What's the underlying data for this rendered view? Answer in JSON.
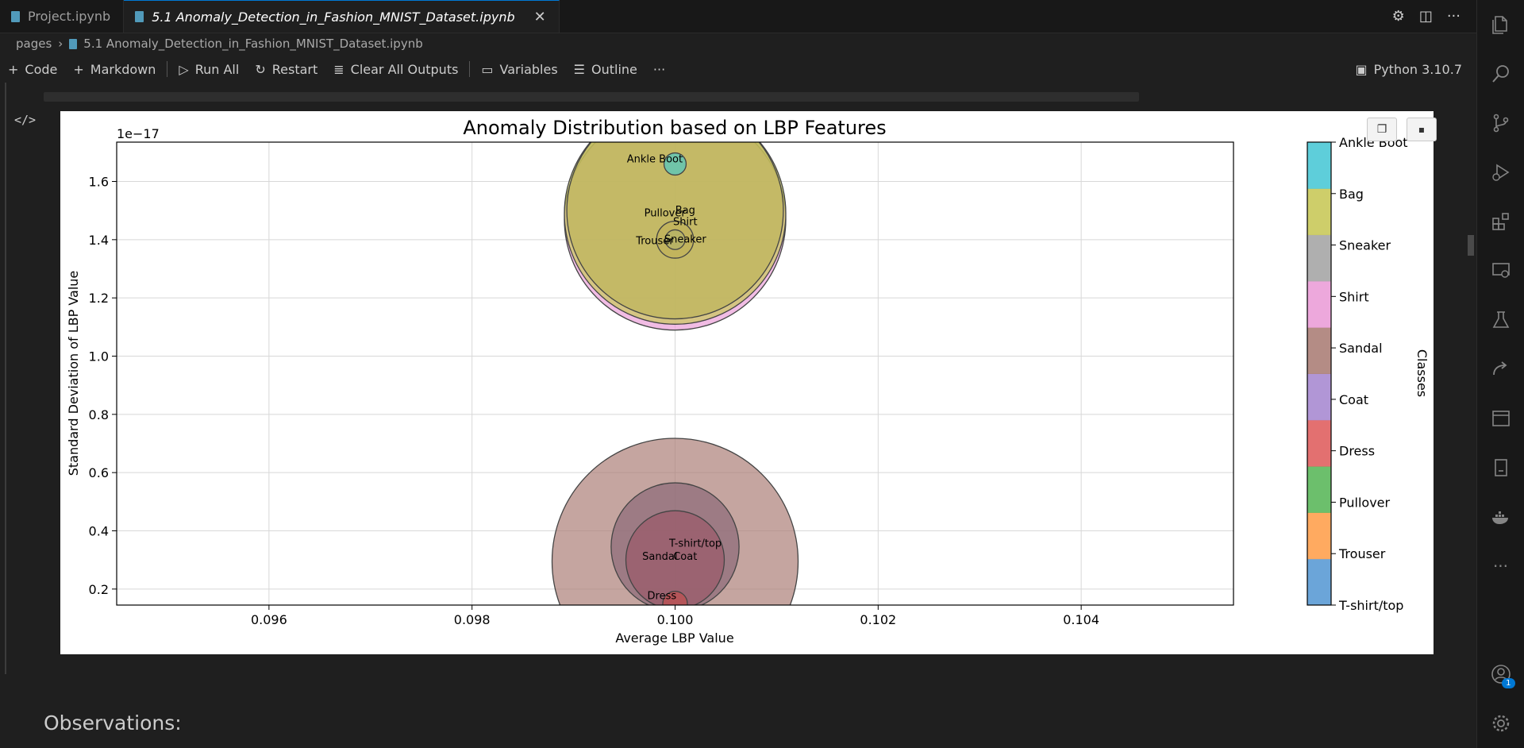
{
  "tabs": [
    {
      "label": "Project.ipynb",
      "active": false
    },
    {
      "label": "5.1 Anomaly_Detection_in_Fashion_MNIST_Dataset.ipynb",
      "active": true
    }
  ],
  "breadcrumb": {
    "folder": "pages",
    "file": "5.1 Anomaly_Detection_in_Fashion_MNIST_Dataset.ipynb"
  },
  "toolbar": {
    "code": "Code",
    "markdown": "Markdown",
    "run_all": "Run All",
    "restart": "Restart",
    "clear_outputs": "Clear All Outputs",
    "variables": "Variables",
    "outline": "Outline",
    "more": "···",
    "kernel": "Python 3.10.7"
  },
  "activity_badge": "1",
  "markdown_heading": "Observations:",
  "chart_data": {
    "type": "scatter",
    "title": "Anomaly Distribution based on LBP Features",
    "xlabel": "Average LBP Value",
    "ylabel": "Standard Deviation of LBP Value",
    "y_offset_label": "1e−17",
    "xlim": [
      0.0945,
      0.1055
    ],
    "ylim": [
      0.145,
      1.735
    ],
    "x_ticks": [
      "0.096",
      "0.098",
      "0.100",
      "0.102",
      "0.104"
    ],
    "y_ticks": [
      "0.2",
      "0.4",
      "0.6",
      "0.8",
      "1.0",
      "1.2",
      "1.4",
      "1.6"
    ],
    "grid": true,
    "colorbar": {
      "label": "Classes",
      "classes": [
        "T-shirt/top",
        "Trouser",
        "Pullover",
        "Dress",
        "Coat",
        "Sandal",
        "Shirt",
        "Sneaker",
        "Bag",
        "Ankle Boot"
      ],
      "colors": [
        "#5b9bd5",
        "#ffa14f",
        "#5cb85c",
        "#e06060",
        "#a98bd2",
        "#ac7f78",
        "#eb9fd8",
        "#a6a6a6",
        "#c9c95a",
        "#4dc9d6"
      ]
    },
    "points": [
      {
        "label": "Sandal",
        "x": 0.1,
        "y": 0.295,
        "size": 1.0,
        "color": "#ac7f78"
      },
      {
        "label": "T-shirt/top",
        "x": 0.1,
        "y": 0.345,
        "size": 0.52,
        "color": "#8c6a78"
      },
      {
        "label": "Coat",
        "x": 0.1,
        "y": 0.3,
        "size": 0.4,
        "color": "#9a5a6a"
      },
      {
        "label": "Dress",
        "x": 0.1,
        "y": 0.15,
        "size": 0.1,
        "color": "#c05050"
      },
      {
        "label": "Shirt",
        "x": 0.1,
        "y": 1.47,
        "size": 0.9,
        "color": "#eb9fd8"
      },
      {
        "label": "Bag",
        "x": 0.1,
        "y": 1.49,
        "size": 0.9,
        "color": "#c9c95a"
      },
      {
        "label": "Pullover",
        "x": 0.1,
        "y": 1.5,
        "size": 0.88,
        "color": "#bcb45a"
      },
      {
        "label": "Trouser",
        "x": 0.1,
        "y": 1.4,
        "size": 0.15,
        "color": "#c2b25a"
      },
      {
        "label": "Sneaker",
        "x": 0.1,
        "y": 1.4,
        "size": 0.08,
        "color": "#b4b26a"
      },
      {
        "label": "Ankle Boot",
        "x": 0.1,
        "y": 1.66,
        "size": 0.09,
        "color": "#4dc9c6"
      }
    ],
    "annotations": [
      {
        "text": "Ankle Boot",
        "x": 0.0998,
        "y": 1.665
      },
      {
        "text": "Pullover",
        "x": 0.0999,
        "y": 1.48
      },
      {
        "text": "Bag",
        "x": 0.1001,
        "y": 1.49
      },
      {
        "text": "Shirt",
        "x": 0.1001,
        "y": 1.45
      },
      {
        "text": "Trouser",
        "x": 0.0998,
        "y": 1.385
      },
      {
        "text": "Sneaker",
        "x": 0.1001,
        "y": 1.39
      },
      {
        "text": "T-shirt/top",
        "x": 0.1002,
        "y": 0.345
      },
      {
        "text": "Sandal",
        "x": 0.09985,
        "y": 0.3
      },
      {
        "text": "Coat",
        "x": 0.1001,
        "y": 0.3
      },
      {
        "text": "Dress",
        "x": 0.09987,
        "y": 0.165
      }
    ]
  }
}
